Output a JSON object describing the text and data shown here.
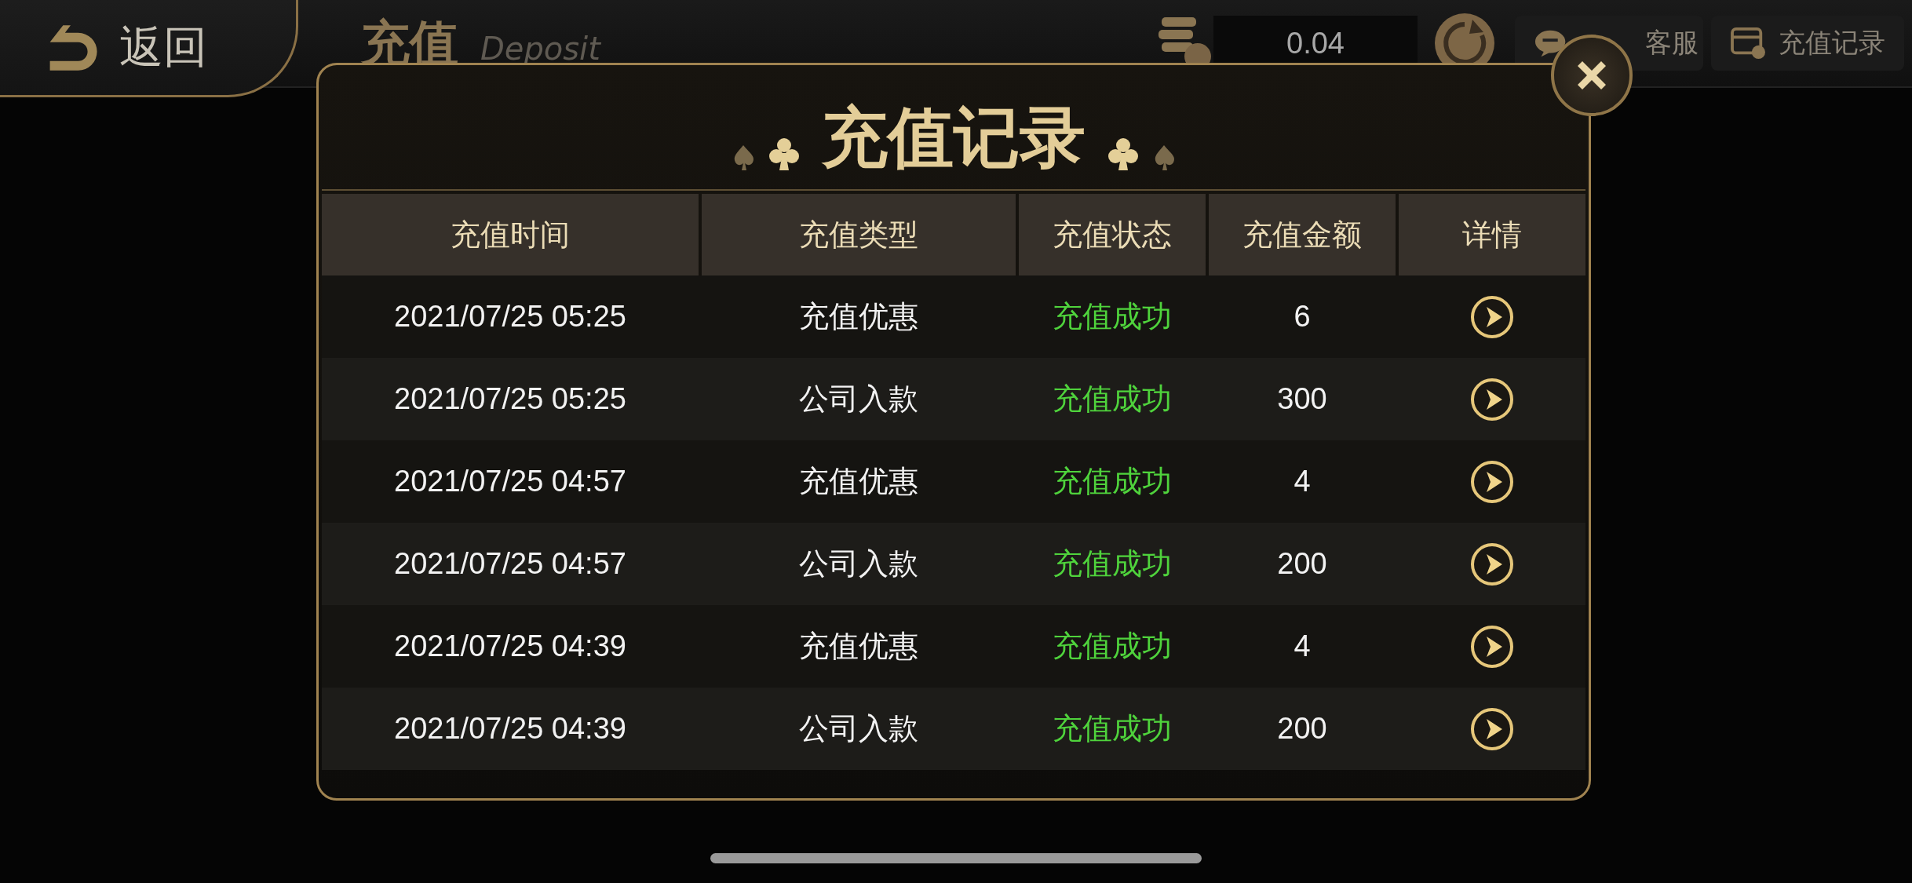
{
  "top_bar": {
    "back_label": "返回",
    "title": "充值",
    "subtitle": "Deposit",
    "balance": "0.04",
    "service_label": "客服",
    "records_label": "充值记录"
  },
  "dialog": {
    "title": "充值记录",
    "columns": [
      "充值时间",
      "充值类型",
      "充值状态",
      "充值金额",
      "详情"
    ],
    "rows": [
      {
        "time": "2021/07/25 05:25",
        "type": "充值优惠",
        "status": "充值成功",
        "amount": "6"
      },
      {
        "time": "2021/07/25 05:25",
        "type": "公司入款",
        "status": "充值成功",
        "amount": "300"
      },
      {
        "time": "2021/07/25 04:57",
        "type": "充值优惠",
        "status": "充值成功",
        "amount": "4"
      },
      {
        "time": "2021/07/25 04:57",
        "type": "公司入款",
        "status": "充值成功",
        "amount": "200"
      },
      {
        "time": "2021/07/25 04:39",
        "type": "充值优惠",
        "status": "充值成功",
        "amount": "4"
      },
      {
        "time": "2021/07/25 04:39",
        "type": "公司入款",
        "status": "充值成功",
        "amount": "200"
      }
    ]
  }
}
